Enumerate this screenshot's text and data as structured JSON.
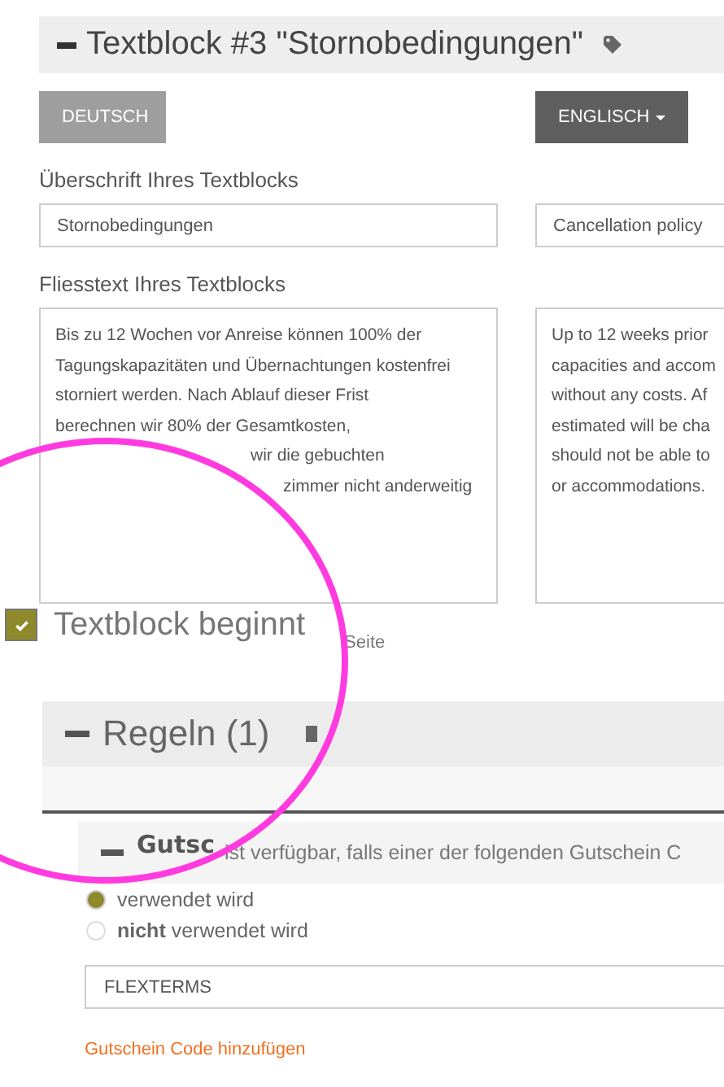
{
  "textblock": {
    "title": "Textblock #3 \"Stornobedingungen\"",
    "languages": [
      {
        "label": "DEUTSCH",
        "selected": false
      },
      {
        "label": "ENGLISCH",
        "selected": true
      }
    ],
    "heading_label": "Überschrift Ihres Textblocks",
    "headings": [
      "Stornobedingungen",
      "Cancellation policy"
    ],
    "body_label": "Fliesstext Ihres Textblocks",
    "bodies": [
      [
        "Bis zu 12 Wochen vor Anreise können 100% der",
        "Tagungskapazitäten und Übernachtungen kostenfrei",
        "storniert werden. Nach Ablauf dieser Frist",
        "berechnen wir 80% der Gesamtkosten,",
        "wir die gebuchten",
        "zimmer nicht anderweitig"
      ],
      [
        "Up to 12 weeks prior",
        "capacities and accom",
        "without any costs. Af",
        "estimated will be cha",
        "should not be able to",
        "or accommodations."
      ]
    ],
    "new_page": {
      "label": "Textblock beginnt",
      "label_tail": "Seite",
      "checked": true
    }
  },
  "rules": {
    "title": "Regeln (1)",
    "voucher": {
      "title": "Gutsc",
      "description": "ist verfügbar, falls einer der folgenden Gutschein C",
      "options": [
        {
          "label": "verwendet wird",
          "selected": true
        },
        {
          "label": "**nicht** verwendet wird",
          "selected": false
        }
      ],
      "code": "FLEXTERMS",
      "add_link": "Gutschein Code hinzufügen"
    }
  }
}
